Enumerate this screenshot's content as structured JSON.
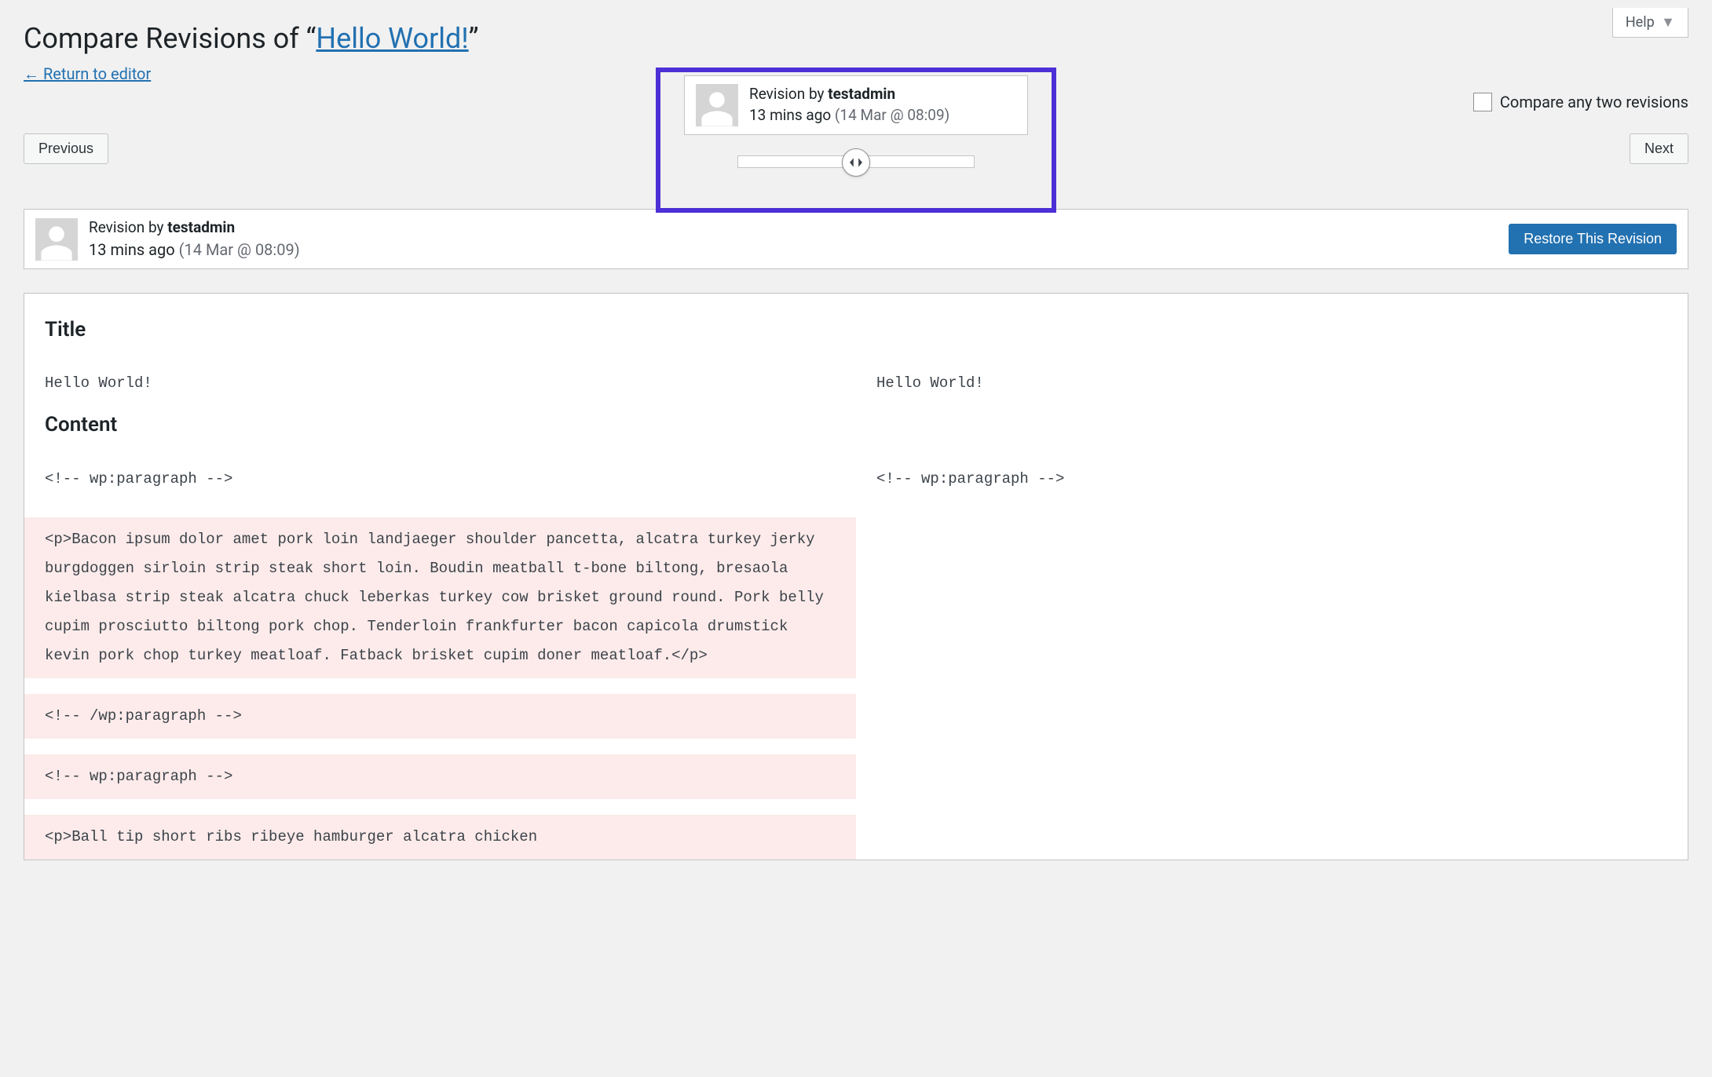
{
  "help": {
    "label": "Help"
  },
  "header": {
    "prefix": "Compare Revisions of “",
    "title_link": "Hello World!",
    "suffix": "”",
    "return_label": "Return to editor"
  },
  "nav": {
    "previous": "Previous",
    "next": "Next"
  },
  "compare_toggle": {
    "label": "Compare any two revisions"
  },
  "tooltip": {
    "by_prefix": "Revision by ",
    "author": "testadmin",
    "ago": "13 mins ago",
    "date": "(14 Mar @ 08:09)"
  },
  "meta": {
    "by_prefix": "Revision by ",
    "author": "testadmin",
    "ago": "13 mins ago",
    "date": "(14 Mar @ 08:09)",
    "restore_button": "Restore This Revision"
  },
  "diff": {
    "title_heading": "Title",
    "content_heading": "Content",
    "title_left": "Hello World!",
    "title_right": "Hello World!",
    "rows": [
      {
        "type": "context",
        "left": "<!-- wp:paragraph -->",
        "right": "<!-- wp:paragraph -->"
      },
      {
        "type": "del",
        "left": "<p>Bacon ipsum dolor amet pork loin landjaeger shoulder pancetta, alcatra turkey jerky burgdoggen sirloin strip steak short loin. Boudin meatball t-bone biltong, bresaola kielbasa strip steak alcatra chuck leberkas turkey cow brisket ground round. Pork belly cupim prosciutto biltong pork chop. Tenderloin frankfurter bacon capicola drumstick kevin pork chop turkey meatloaf. Fatback brisket cupim doner meatloaf.</p>",
        "right": ""
      },
      {
        "type": "del",
        "left": "<!-- /wp:paragraph -->",
        "right": ""
      },
      {
        "type": "del",
        "left": "<!-- wp:paragraph -->",
        "right": ""
      },
      {
        "type": "del",
        "left": "<p>Ball tip short ribs ribeye hamburger alcatra chicken",
        "right": ""
      }
    ]
  }
}
